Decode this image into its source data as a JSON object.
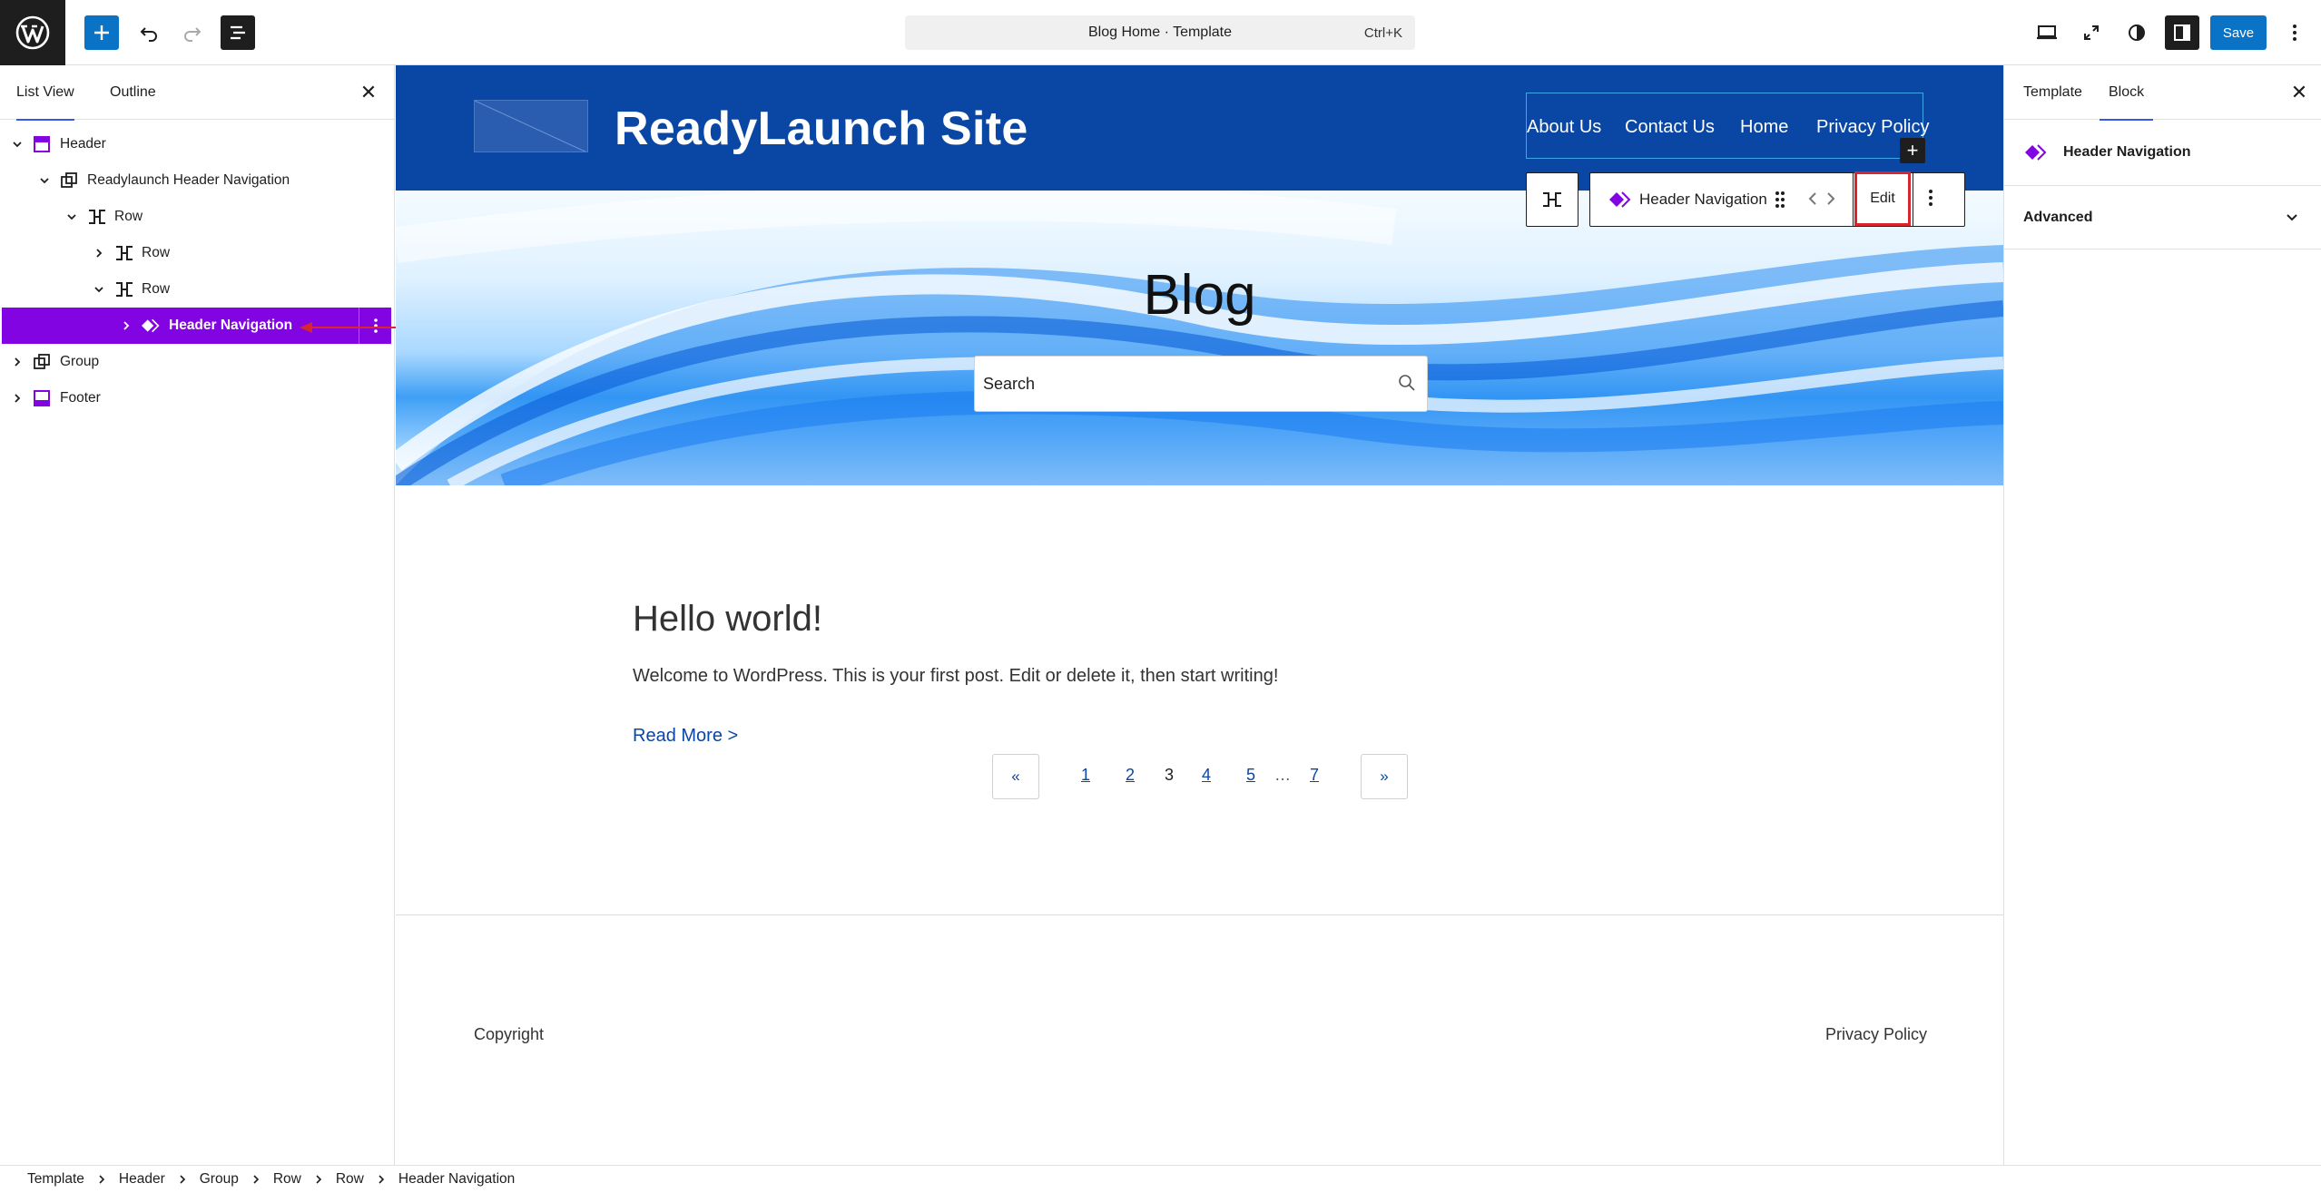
{
  "topbar": {
    "command_title": "Blog Home · Template",
    "command_shortcut": "Ctrl+K",
    "save_label": "Save"
  },
  "left_panel": {
    "tabs": [
      {
        "label": "List View",
        "active": true
      },
      {
        "label": "Outline",
        "active": false
      }
    ],
    "tree": [
      {
        "label": "Header",
        "depth": 0,
        "expanded": true,
        "icon": "template-part-icon"
      },
      {
        "label": "Readylaunch Header Navigation",
        "depth": 1,
        "expanded": true,
        "icon": "group-icon"
      },
      {
        "label": "Row",
        "depth": 2,
        "expanded": true,
        "icon": "row-icon"
      },
      {
        "label": "Row",
        "depth": 3,
        "expanded": false,
        "icon": "row-icon"
      },
      {
        "label": "Row",
        "depth": 3,
        "expanded": true,
        "icon": "row-icon"
      },
      {
        "label": "Header Navigation",
        "depth": 4,
        "expanded": false,
        "icon": "diamond-block-icon",
        "selected": true
      },
      {
        "label": "Group",
        "depth": 0,
        "expanded": false,
        "icon": "group-icon"
      },
      {
        "label": "Footer",
        "depth": 0,
        "expanded": false,
        "icon": "template-part-icon"
      }
    ]
  },
  "canvas": {
    "site_title": "ReadyLaunch Site",
    "nav": [
      "About Us",
      "Contact Us",
      "Home",
      "Privacy Policy"
    ],
    "block_toolbar": {
      "block_name": "Header Navigation",
      "edit_label": "Edit"
    },
    "blog_title": "Blog",
    "search_placeholder": "Search",
    "post": {
      "title": "Hello world!",
      "excerpt": "Welcome to WordPress. This is your first post. Edit or delete it, then start writing!",
      "read_more": "Read More >"
    },
    "pagination": {
      "prev": "«",
      "next": "»",
      "pages": [
        "1",
        "2",
        "3",
        "4",
        "5",
        "…",
        "7"
      ],
      "current": "3"
    },
    "footer": {
      "copyright": "Copyright",
      "privacy": "Privacy Policy"
    }
  },
  "right_panel": {
    "tabs": [
      {
        "label": "Template",
        "active": false
      },
      {
        "label": "Block",
        "active": true
      }
    ],
    "block_name": "Header Navigation",
    "advanced_label": "Advanced"
  },
  "breadcrumbs": [
    "Template",
    "Header",
    "Group",
    "Row",
    "Row",
    "Header Navigation"
  ],
  "colors": {
    "accent": "#8204e3",
    "header_bg": "#0a46a3",
    "wp_blue": "#0b73c6",
    "highlight_red": "#d7262e"
  }
}
